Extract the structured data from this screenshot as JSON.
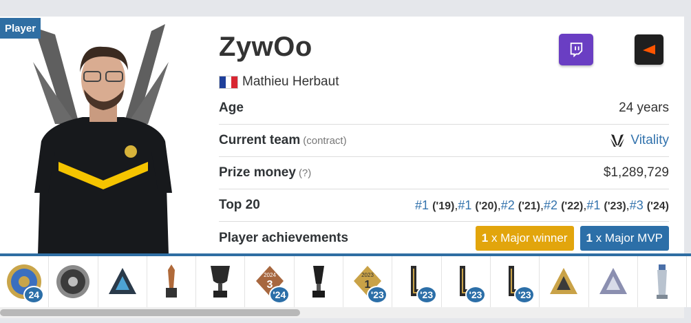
{
  "tag": "Player",
  "player": {
    "nickname": "ZywOo",
    "real_name": "Mathieu Herbaut",
    "flag": "france-flag"
  },
  "social": {
    "twitch_icon": "twitch-icon",
    "faceit_icon": "faceit-icon",
    "twitch_color": "#6a3ec3"
  },
  "info": {
    "age_label": "Age",
    "age_value": "24 years",
    "team_label": "Current team",
    "team_sub": "(contract)",
    "team_value": "Vitality",
    "prize_label": "Prize money",
    "prize_sub": "(?)",
    "prize_value": "$1,289,729",
    "top20_label": "Top 20",
    "top20": [
      {
        "rank": "#1",
        "year": "('19)"
      },
      {
        "rank": "#1",
        "year": "('20)"
      },
      {
        "rank": "#2",
        "year": "('21)"
      },
      {
        "rank": "#2",
        "year": "('22)"
      },
      {
        "rank": "#1",
        "year": "('23)"
      },
      {
        "rank": "#3",
        "year": "('24)"
      }
    ],
    "achievements_label": "Player achievements",
    "major_winner_count": "1",
    "major_winner_text": "x Major winner",
    "major_mvp_count": "1",
    "major_mvp_text": "x Major MVP"
  },
  "trophies": [
    {
      "icon": "gold-coin-trophy-icon",
      "year": "24"
    },
    {
      "icon": "silver-coin-trophy-icon",
      "year": ""
    },
    {
      "icon": "blast-logo-trophy-icon",
      "year": ""
    },
    {
      "icon": "bronze-figure-trophy-icon",
      "year": ""
    },
    {
      "icon": "dark-cup-trophy-icon",
      "year": ""
    },
    {
      "icon": "ranking-3-2024-trophy-icon",
      "year": "'24",
      "top": "2024",
      "num": "3"
    },
    {
      "icon": "dark-chalice-trophy-icon",
      "year": ""
    },
    {
      "icon": "ranking-1-2023-trophy-icon",
      "year": "'23",
      "top": "2023",
      "num": "1"
    },
    {
      "icon": "gold-l-trophy-icon",
      "year": "'23"
    },
    {
      "icon": "gold-l-trophy-icon",
      "year": "'23"
    },
    {
      "icon": "gold-l-trophy-icon",
      "year": "'23"
    },
    {
      "icon": "gold-blast-trophy-icon",
      "year": ""
    },
    {
      "icon": "silver-blast-trophy-icon",
      "year": ""
    },
    {
      "icon": "silver-bottle-trophy-icon",
      "year": ""
    }
  ]
}
